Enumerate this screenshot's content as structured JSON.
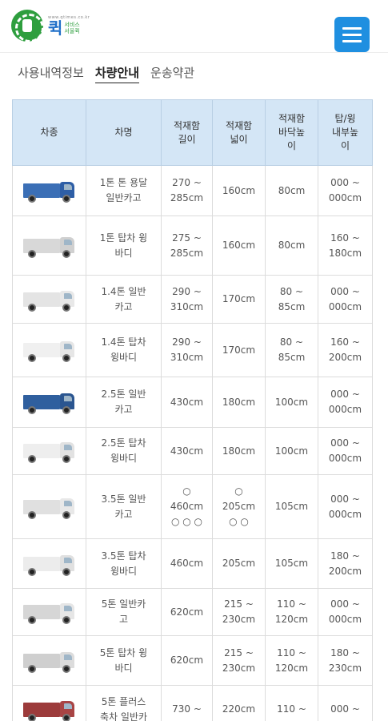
{
  "header": {
    "logo_small": "www.qtimes.co.kr",
    "logo_main": "퀵",
    "logo_sub_1": "서비스",
    "logo_sub_2": "서울퀵",
    "menu_icon": "hamburger-menu-icon",
    "menu_color": "#1f8fe0"
  },
  "tabs": [
    {
      "label": "사용내역정보",
      "active": false
    },
    {
      "label": "차량안내",
      "active": true
    },
    {
      "label": "운송약관",
      "active": false
    }
  ],
  "table": {
    "headers": [
      "차종",
      "차명",
      "적재함\n길이",
      "적재함\n넓이",
      "적재함\n바닥높\n이",
      "탑/윙\n내부높\n이"
    ],
    "rows": [
      {
        "image": "blue-cargo-truck",
        "cargo_color": "#3b6fb6",
        "cabin_color": "#2e5ea6",
        "name": "1톤 톤 용달\n일반카고",
        "length": "270 ~\n285cm",
        "width": "160cm",
        "floor": "80cm",
        "inner": "000 ~\n000cm"
      },
      {
        "image": "wing-body-truck",
        "cargo_color": "#d8d8d8",
        "cabin_color": "#d0d0d0",
        "name": "1톤 탑차 윙\n바디",
        "length": "275 ~\n285cm",
        "width": "160cm",
        "floor": "80cm",
        "inner": "160 ~\n180cm"
      },
      {
        "image": "white-cargo-truck",
        "cargo_color": "#e4e4e4",
        "cabin_color": "#e8e8e8",
        "name": "1.4톤 일반\n카고",
        "length": "290 ~\n310cm",
        "width": "170cm",
        "floor": "80 ~\n85cm",
        "inner": "000 ~\n000cm"
      },
      {
        "image": "white-box-truck",
        "cargo_color": "#f0f0f0",
        "cabin_color": "#e6e6e6",
        "name": "1.4톤 탑차\n윙바디",
        "length": "290 ~\n310cm",
        "width": "170cm",
        "floor": "80 ~\n85cm",
        "inner": "160 ~\n200cm"
      },
      {
        "image": "blue-cargo-truck",
        "cargo_color": "#2f5f9e",
        "cabin_color": "#2a5590",
        "name": "2.5톤 일반\n카고",
        "length": "430cm",
        "width": "180cm",
        "floor": "100cm",
        "inner": "000 ~\n000cm"
      },
      {
        "image": "white-box-truck",
        "cargo_color": "#eeeeee",
        "cabin_color": "#e2e2e2",
        "name": "2.5톤 탑차\n윙바디",
        "length": "430cm",
        "width": "180cm",
        "floor": "100cm",
        "inner": "000 ~\n000cm"
      },
      {
        "image": "white-cargo-truck",
        "cargo_color": "#e0e0e0",
        "cabin_color": "#e8e8e8",
        "name": "3.5톤 일반\n카고",
        "length": "○\n460cm\n○ ○ ○",
        "width": "○\n205cm\n○ ○",
        "floor": "105cm",
        "inner": "000 ~\n000cm"
      },
      {
        "image": "white-box-truck",
        "cargo_color": "#ececec",
        "cabin_color": "#e0e0e0",
        "name": "3.5톤 탑차\n윙바디",
        "length": "460cm",
        "width": "205cm",
        "floor": "105cm",
        "inner": "180 ~\n200cm"
      },
      {
        "image": "white-cargo-truck",
        "cargo_color": "#d6d6d6",
        "cabin_color": "#e6e6e6",
        "name": "5톤 일반카\n고",
        "length": "620cm",
        "width": "215 ~\n230cm",
        "floor": "110 ~\n120cm",
        "inner": "000 ~\n000cm"
      },
      {
        "image": "wing-body-truck",
        "cargo_color": "#cfcfcf",
        "cabin_color": "#dcdcdc",
        "name": "5톤 탑차 윙\n바디",
        "length": "620cm",
        "width": "215 ~\n230cm",
        "floor": "110 ~\n120cm",
        "inner": "180 ~\n230cm"
      },
      {
        "image": "red-cargo-truck",
        "cargo_color": "#9c3b3b",
        "cabin_color": "#a84444",
        "name": "5톤 플러스\n축차 일반카",
        "length": "730 ~",
        "width": "220cm",
        "floor": "110 ~",
        "inner": "000 ~"
      }
    ]
  }
}
